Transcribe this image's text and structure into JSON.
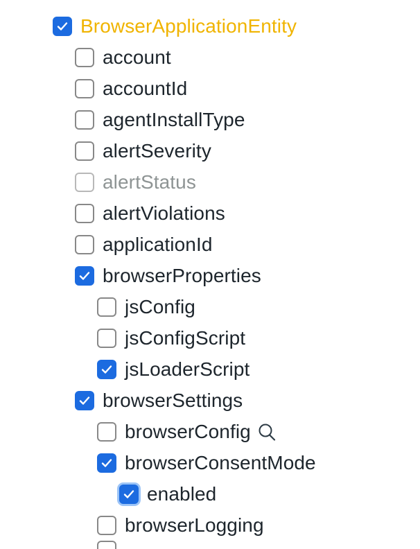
{
  "tree": {
    "root": {
      "label": "BrowserApplicationEntity",
      "checked": true
    },
    "items": [
      {
        "label": "account",
        "checked": false
      },
      {
        "label": "accountId",
        "checked": false
      },
      {
        "label": "agentInstallType",
        "checked": false
      },
      {
        "label": "alertSeverity",
        "checked": false
      },
      {
        "label": "alertStatus",
        "checked": false,
        "muted": true
      },
      {
        "label": "alertViolations",
        "checked": false
      },
      {
        "label": "applicationId",
        "checked": false
      },
      {
        "label": "browserProperties",
        "checked": true
      },
      {
        "label": "jsConfig",
        "checked": false
      },
      {
        "label": "jsConfigScript",
        "checked": false
      },
      {
        "label": "jsLoaderScript",
        "checked": true
      },
      {
        "label": "browserSettings",
        "checked": true
      },
      {
        "label": "browserConfig",
        "checked": false,
        "icon": "search-icon"
      },
      {
        "label": "browserConsentMode",
        "checked": true
      },
      {
        "label": "enabled",
        "checked": true,
        "focused": true
      },
      {
        "label": "browserLogging",
        "checked": false
      }
    ]
  },
  "colors": {
    "checkbox_checked": "#1c6be0",
    "accent_label": "#f0b400",
    "muted_label": "#8e9494",
    "text": "#1d252c"
  }
}
